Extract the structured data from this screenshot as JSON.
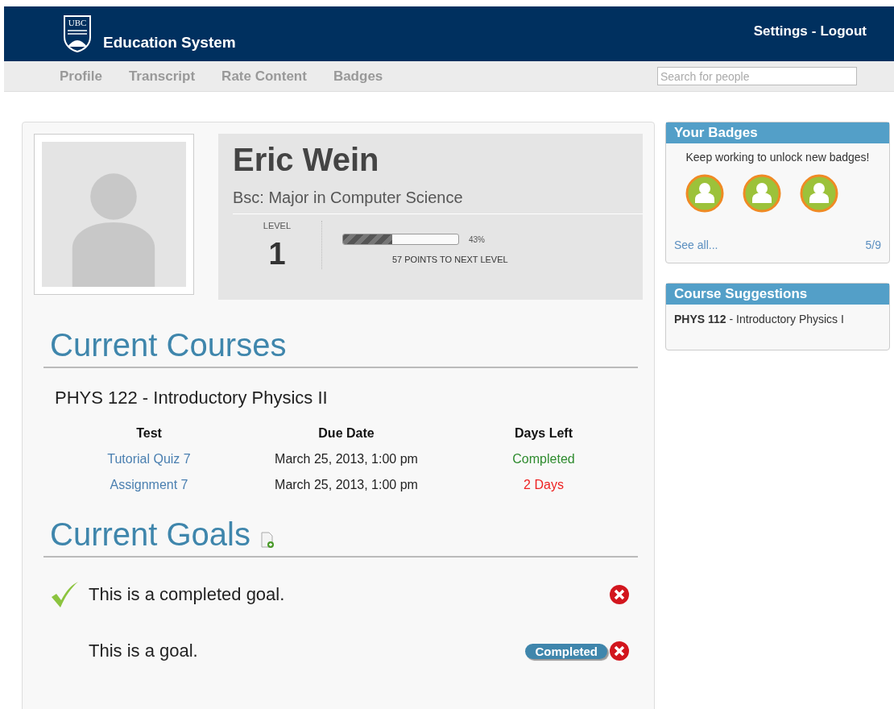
{
  "header": {
    "logo_text": "UBC",
    "title": "Education System",
    "links": [
      "Settings",
      "Logout"
    ],
    "separator": "-"
  },
  "nav": {
    "items": [
      {
        "label": "Profile",
        "selected": false
      },
      {
        "label": "Transcript",
        "selected": false
      },
      {
        "label": "Rate Content",
        "selected": false
      },
      {
        "label": "Badges",
        "selected": false
      }
    ],
    "search": {
      "placeholder": "Search for people"
    }
  },
  "profile": {
    "name": "Eric Wein",
    "program": "Bsc: Major in Computer Science",
    "level_label": "LEVEL",
    "level_value": "1",
    "progress": {
      "level": 0.43,
      "reading": "43%",
      "caption": "57 POINTS TO NEXT LEVEL"
    }
  },
  "courses": {
    "title": "Current Courses",
    "items": [
      {
        "name": "PHYS 122 - Introductory Physics II",
        "columns": [
          "Test",
          "Due Date",
          "Days Left"
        ],
        "rows": [
          {
            "test": "Tutorial Quiz 7",
            "due": "March 25, 2013, 1:00 pm",
            "days_left": "Completed",
            "kind": "done"
          },
          {
            "test": "Assignment 7",
            "due": "March 25, 2013, 1:00 pm",
            "days_left": "2 Days",
            "kind": "pending"
          }
        ]
      }
    ]
  },
  "goals": {
    "title": "Current Goals",
    "items": [
      {
        "text": "This is a completed goal.",
        "completed": true
      },
      {
        "text": "This is a goal.",
        "completed": false,
        "button": "Completed"
      }
    ]
  },
  "badges": {
    "title": "Your Badges",
    "message": "Keep working to unlock new badges!",
    "items": [
      {
        "kind": "person"
      },
      {
        "kind": "person"
      },
      {
        "kind": "person"
      }
    ],
    "see_all": "See all...",
    "progress": "5/9"
  },
  "suggestions": {
    "title": "Course Suggestions",
    "items": [
      {
        "code": "PHYS 112",
        "separator": "-",
        "name": "Introductory Physics I"
      }
    ]
  }
}
